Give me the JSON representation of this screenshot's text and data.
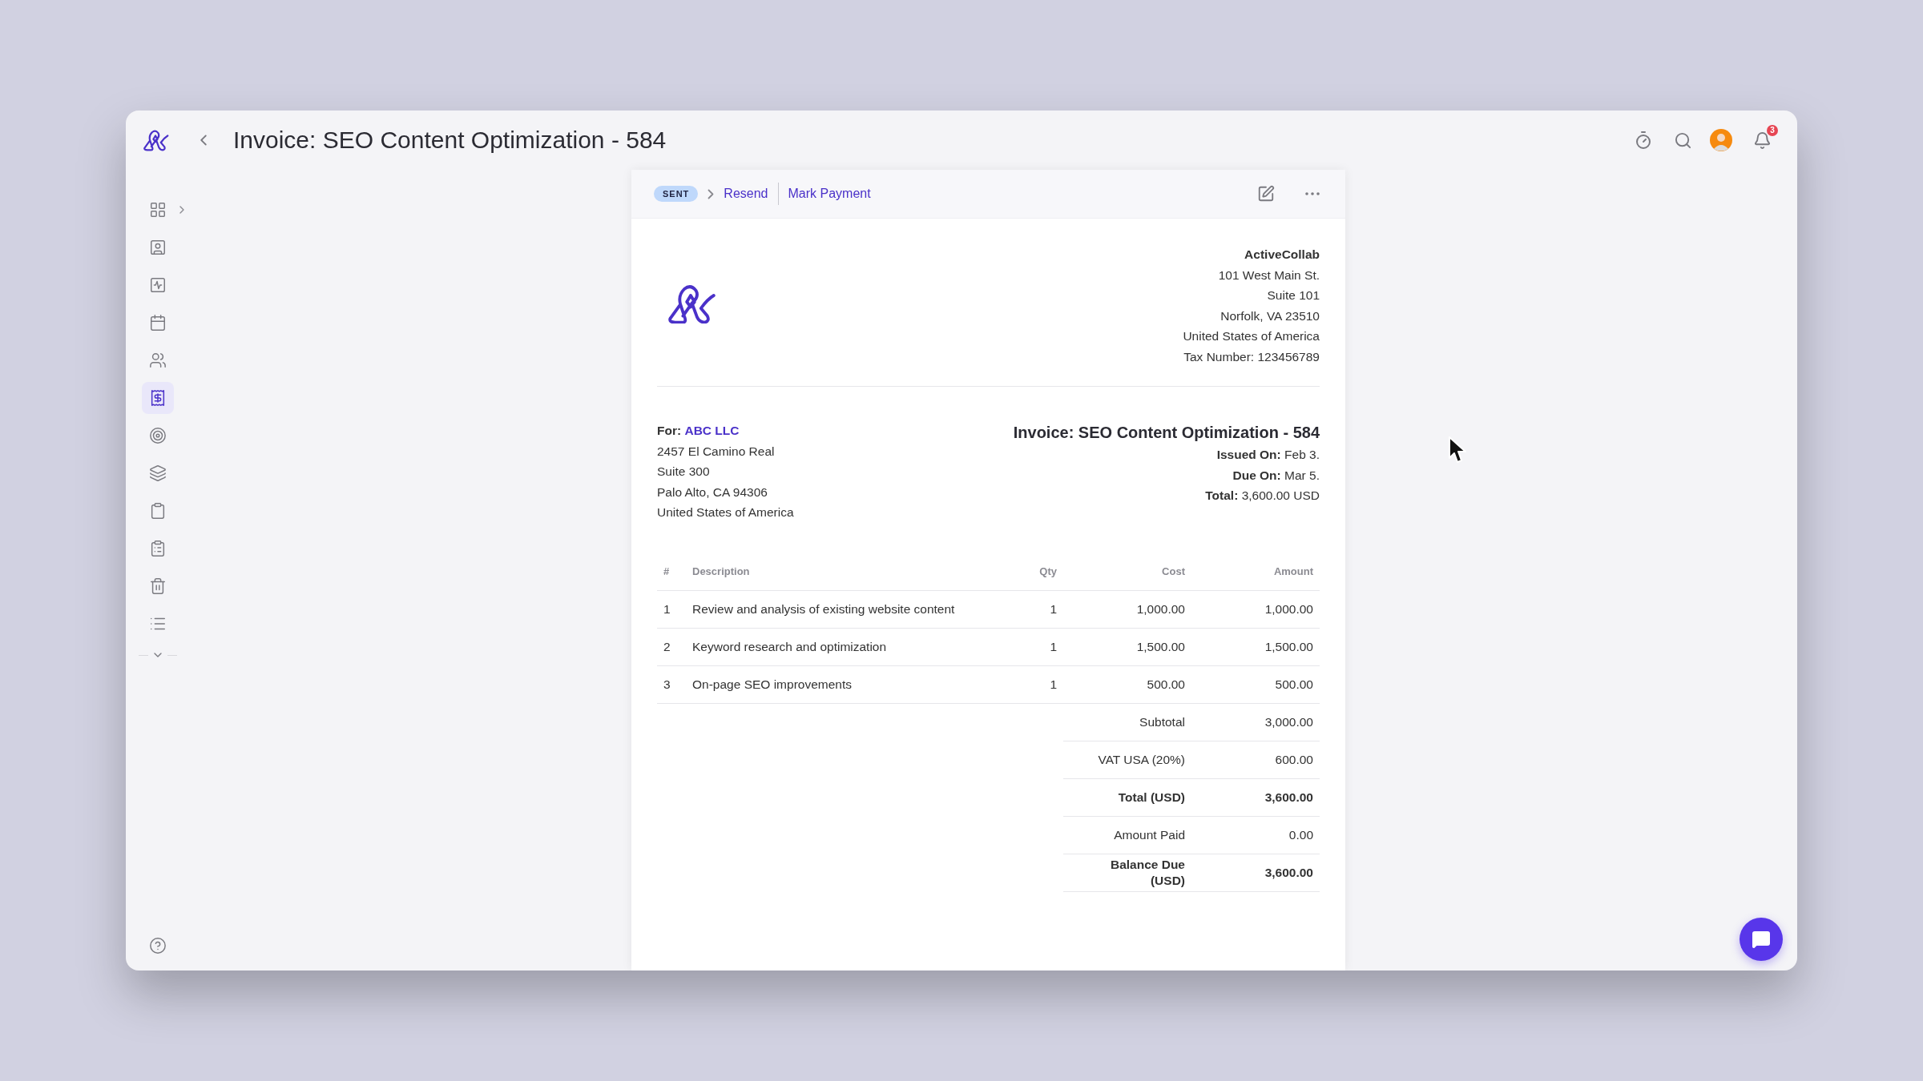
{
  "app_bar": {
    "title": "Invoice: SEO Content Optimization - 584",
    "notification_count": "3"
  },
  "sidebar": {
    "items": [
      {
        "selected": false
      },
      {
        "selected": false
      },
      {
        "selected": false
      },
      {
        "selected": false
      },
      {
        "selected": false
      },
      {
        "selected": true
      },
      {
        "selected": false
      },
      {
        "selected": false
      },
      {
        "selected": false
      },
      {
        "selected": false
      },
      {
        "selected": false
      },
      {
        "selected": false
      }
    ]
  },
  "invoice": {
    "status": "SENT",
    "actions": [
      "Resend",
      "Mark Payment"
    ],
    "company": {
      "name": "ActiveCollab",
      "lines": [
        "101 West Main St.",
        "Suite 101",
        "Norfolk, VA 23510",
        "United States of America",
        "Tax Number: 123456789"
      ]
    },
    "client": {
      "label": "For:",
      "name": "ABC LLC",
      "lines": [
        "2457 El Camino Real",
        "Suite 300",
        "Palo Alto, CA 94306",
        "United States of America"
      ]
    },
    "title": "Invoice: SEO Content Optimization - 584",
    "meta": [
      {
        "label": "Issued On:",
        "value": "Feb 3."
      },
      {
        "label": "Due On:",
        "value": "Mar 5."
      },
      {
        "label": "Total:",
        "value": "3,600.00 USD"
      }
    ],
    "table": {
      "columns": [
        "#",
        "Description",
        "Qty",
        "Cost",
        "Amount"
      ],
      "rows": [
        [
          "1",
          "Review and analysis of existing website content",
          "1",
          "1,000.00",
          "1,000.00"
        ],
        [
          "2",
          "Keyword research and optimization",
          "1",
          "1,500.00",
          "1,500.00"
        ],
        [
          "3",
          "On-page SEO improvements",
          "1",
          "500.00",
          "500.00"
        ]
      ]
    },
    "totals": [
      {
        "label": "Subtotal",
        "value": "3,000.00",
        "bold": false
      },
      {
        "label": "VAT USA (20%)",
        "value": "600.00",
        "bold": false
      },
      {
        "label": "Total (USD)",
        "value": "3,600.00",
        "bold": true
      },
      {
        "label": "Amount Paid",
        "value": "0.00",
        "bold": false
      },
      {
        "label": "Balance Due (USD)",
        "value": "3,600.00",
        "bold": true
      }
    ]
  }
}
